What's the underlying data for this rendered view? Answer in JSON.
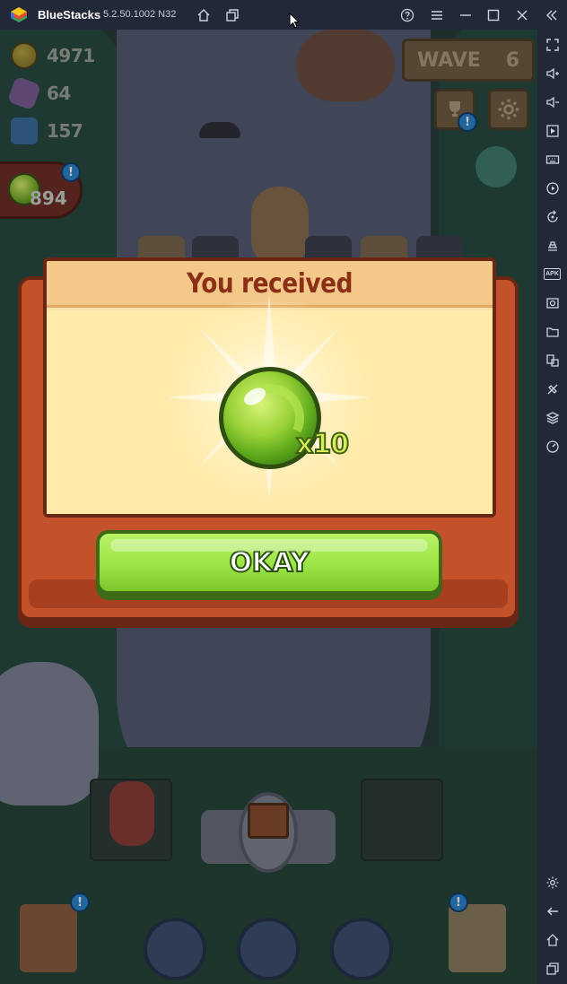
{
  "window": {
    "app_name": "BlueStacks",
    "version": "5.2.50.1002 N32",
    "controls": [
      "help-icon",
      "menu-icon",
      "minimize-icon",
      "maximize-icon",
      "close-icon",
      "collapse-sidebar-icon"
    ]
  },
  "sidebar": {
    "apk_label": "APK",
    "tools": [
      "fullscreen-icon",
      "volume-up-icon",
      "volume-down-icon",
      "cast-icon",
      "keyboard-icon",
      "macro-record-icon",
      "rotate-icon",
      "gamepad-icon",
      "apk-install-icon",
      "screenshot-icon",
      "folder-icon",
      "multi-instance-icon",
      "eco-mode-icon",
      "layers-icon",
      "speed-icon",
      "settings-icon",
      "back-icon",
      "home-icon",
      "recent-apps-icon"
    ]
  },
  "hud": {
    "gold": "4971",
    "crystals": "64",
    "stones": "157",
    "green_gems": "894",
    "wave_label": "WAVE",
    "wave_number": "6",
    "alert_mark": "!"
  },
  "modal": {
    "title": "You received",
    "item_icon": "green-orb-icon",
    "quantity": "x10",
    "confirm_label": "OKAY"
  },
  "colors": {
    "titlebar": "#232838",
    "modal_frame": "#c3522b",
    "parchment": "#ffeaaa",
    "title_text": "#8b2f17",
    "okay_button": "#9be447"
  }
}
